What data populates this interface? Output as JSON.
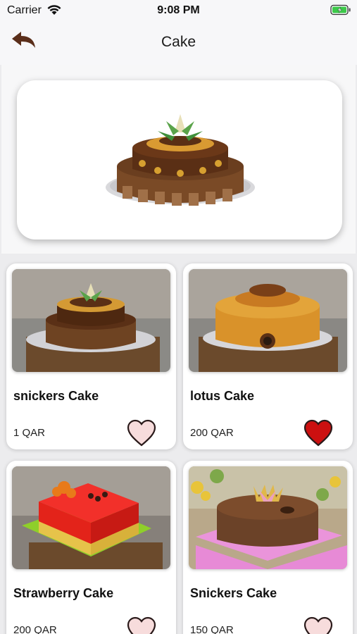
{
  "status_bar": {
    "carrier": "Carrier",
    "time": "9:08 PM"
  },
  "nav": {
    "title": "Cake"
  },
  "colors": {
    "accent_brown": "#5a2e1a",
    "heart_red": "#cc1010",
    "heart_empty": "#f7dcdc"
  },
  "products": [
    {
      "name": "snickers Cake",
      "price": "1 QAR",
      "favorite": false
    },
    {
      "name": "lotus Cake",
      "price": "200 QAR",
      "favorite": true
    },
    {
      "name": "Strawberry Cake",
      "price": "200 QAR",
      "favorite": false
    },
    {
      "name": "Snickers Cake",
      "price": "150 QAR",
      "favorite": false
    }
  ]
}
